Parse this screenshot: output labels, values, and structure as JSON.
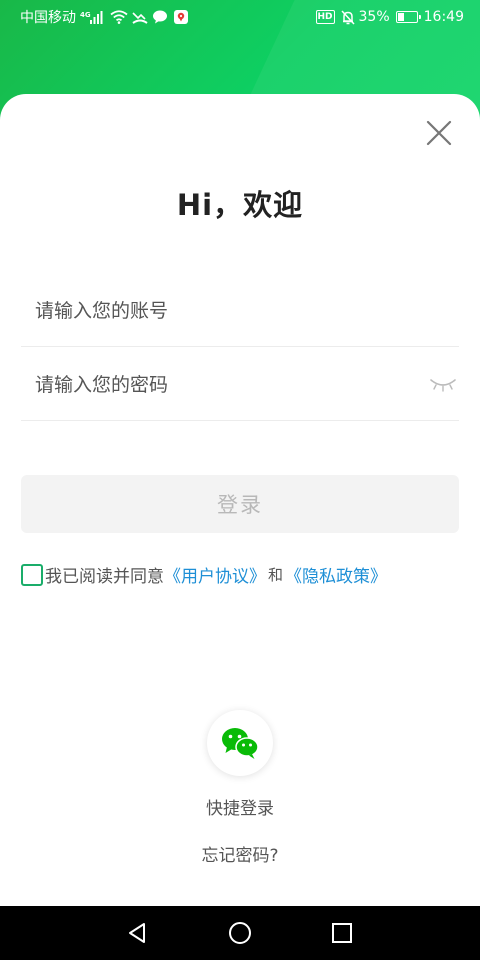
{
  "status_bar": {
    "carrier": "中国移动",
    "network_type": "4G",
    "battery_percent": "35%",
    "battery_level": 0.35,
    "time": "16:49",
    "hd_label": "HD"
  },
  "login": {
    "title": "Hi，欢迎",
    "account_placeholder": "请输入您的账号",
    "password_placeholder": "请输入您的密码",
    "login_button": "登录",
    "agreement_text": "我已阅读并同意",
    "user_agreement_link": "《用户协议》",
    "and_text": "和",
    "privacy_link": "《隐私政策》",
    "quick_login_label": "快捷登录",
    "forgot_password": "忘记密码?"
  },
  "colors": {
    "brand_green": "#12c95a",
    "wechat_green": "#09bb07",
    "link_blue": "#1e8fd6",
    "checkbox_border": "#1aad6a",
    "button_disabled_bg": "#f3f3f3",
    "button_disabled_text": "#b8b8b8"
  },
  "icons": {
    "close": "close-icon",
    "eye": "eye-closed-icon",
    "wechat": "wechat-icon",
    "nav_back": "back-triangle-icon",
    "nav_home": "home-circle-icon",
    "nav_recent": "recent-square-icon"
  }
}
